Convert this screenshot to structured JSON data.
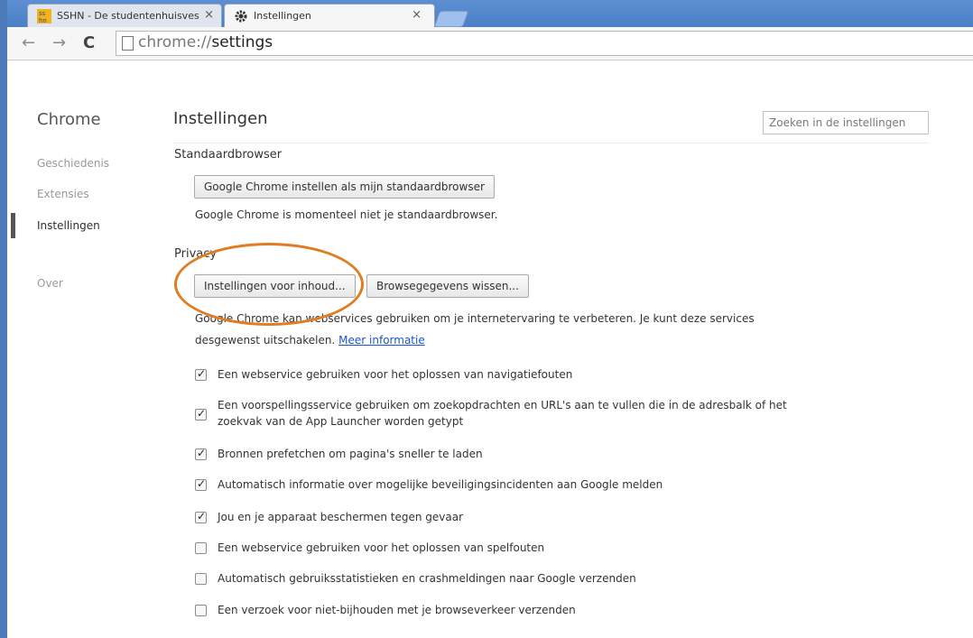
{
  "tabs": [
    {
      "title": "SSHN - De studentenhuisves",
      "favicon": "sshn-logo-icon",
      "active": false
    },
    {
      "title": "Instellingen",
      "favicon": "gear-icon",
      "active": true
    }
  ],
  "address_bar": {
    "scheme": "chrome://",
    "path": "settings"
  },
  "sidebar": {
    "title": "Chrome",
    "items": [
      {
        "label": "Geschiedenis",
        "active": false
      },
      {
        "label": "Extensies",
        "active": false
      },
      {
        "label": "Instellingen",
        "active": true
      },
      {
        "label": "Over",
        "active": false
      }
    ]
  },
  "main": {
    "title": "Instellingen",
    "search_placeholder": "Zoeken in de instellingen",
    "default_browser": {
      "heading": "Standaardbrowser",
      "button": "Google Chrome instellen als mijn standaardbrowser",
      "status": "Google Chrome is momenteel niet je standaardbrowser."
    },
    "privacy": {
      "heading": "Privacy",
      "content_settings_button": "Instellingen voor inhoud...",
      "clear_data_button": "Browsegegevens wissen...",
      "desc_line1": "Google Chrome kan webservices gebruiken om je internetervaring te verbeteren. Je kunt deze services",
      "desc_line2": "desgewenst uitschakelen.",
      "more_info": "Meer informatie",
      "options": [
        {
          "label": "Een webservice gebruiken voor het oplossen van navigatiefouten",
          "checked": true
        },
        {
          "label": "Een voorspellingsservice gebruiken om zoekopdrachten en URL's aan te vullen die in de adresbalk of het",
          "label2": "zoekvak van de App Launcher worden getypt",
          "checked": true
        },
        {
          "label": "Bronnen prefetchen om pagina's sneller te laden",
          "checked": true
        },
        {
          "label": "Automatisch informatie over mogelijke beveiligingsincidenten aan Google melden",
          "checked": true
        },
        {
          "label": "Jou en je apparaat beschermen tegen gevaar",
          "checked": true
        },
        {
          "label": "Een webservice gebruiken voor het oplossen van spelfouten",
          "checked": false
        },
        {
          "label": "Automatisch gebruiksstatistieken en crashmeldingen naar Google verzenden",
          "checked": false
        },
        {
          "label": "Een verzoek voor niet-bijhouden met je browseverkeer verzenden",
          "checked": false
        }
      ]
    }
  },
  "colors": {
    "highlight": "#e07c23",
    "link": "#1a56c7",
    "titlebar": "#4a7fc6"
  }
}
